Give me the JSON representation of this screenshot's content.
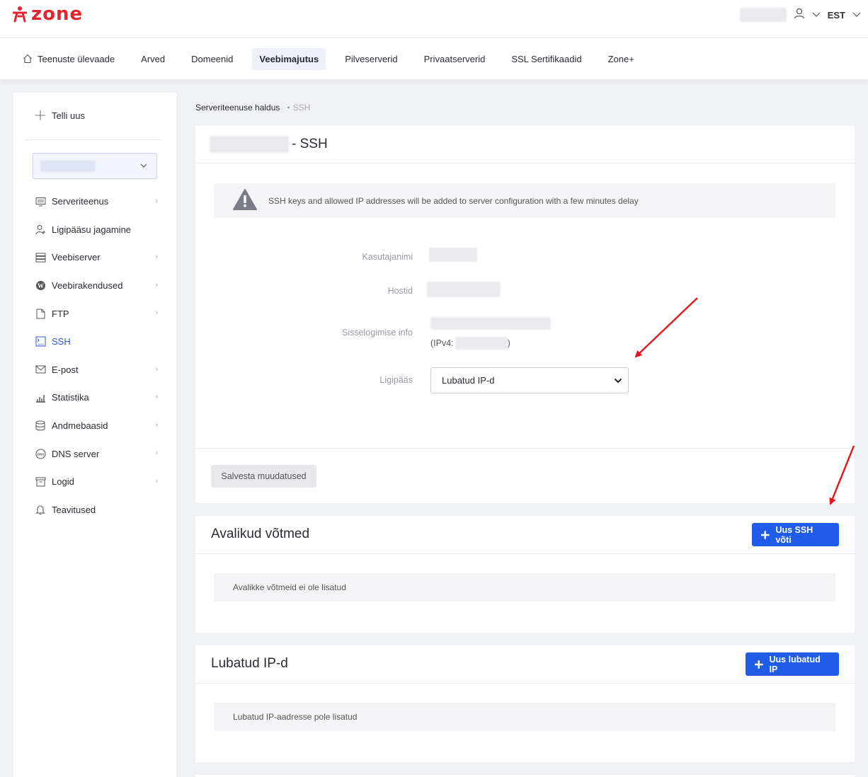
{
  "header": {
    "logo": "zone",
    "language": "EST"
  },
  "nav": {
    "items": [
      {
        "label": "Teenuste ülevaade",
        "icon": "home-icon"
      },
      {
        "label": "Arved"
      },
      {
        "label": "Domeenid"
      },
      {
        "label": "Veebimajutus",
        "active": true
      },
      {
        "label": "Pilveserverid"
      },
      {
        "label": "Privaatserverid"
      },
      {
        "label": "SSL Sertifikaadid"
      },
      {
        "label": "Zone+"
      }
    ]
  },
  "sidebar": {
    "order_new": "Telli uus",
    "items": [
      {
        "label": "Serveriteenus",
        "icon": "monitor-icon"
      },
      {
        "label": "Ligipääsu jagamine",
        "icon": "user-add-icon"
      },
      {
        "label": "Veebiserver",
        "icon": "server-icon"
      },
      {
        "label": "Veebirakendused",
        "icon": "wordpress-icon"
      },
      {
        "label": "FTP",
        "icon": "file-icon"
      },
      {
        "label": "SSH",
        "icon": "terminal-icon"
      },
      {
        "label": "E-post",
        "icon": "mail-icon"
      },
      {
        "label": "Statistika",
        "icon": "chart-icon"
      },
      {
        "label": "Andmebaasid",
        "icon": "database-icon"
      },
      {
        "label": "DNS server",
        "icon": "dns-icon"
      },
      {
        "label": "Logid",
        "icon": "archive-icon"
      },
      {
        "label": "Teavitused",
        "icon": "bell-icon"
      }
    ]
  },
  "breadcrumb": {
    "parent": "Serveriteenuse haldus",
    "current": "SSH"
  },
  "ssh_card": {
    "title_suffix": "- SSH",
    "notice": "SSH keys and allowed IP addresses will be added to server configuration with a few minutes delay",
    "username_label": "Kasutajanimi",
    "host_label": "Hostid",
    "login_label": "Sisselogimise info",
    "ipv4_prefix": "(IPv4:",
    "ipv4_suffix": ")",
    "access_label": "Ligipääs",
    "access_value": "Lubatud IP-d",
    "save_label": "Salvesta muudatused"
  },
  "keys_card": {
    "title": "Avalikud võtmed",
    "button": "Uus SSH võti",
    "empty": "Avalikke võtmeid ei ole lisatud"
  },
  "ips_card": {
    "title": "Lubatud IP-d",
    "button": "Uus lubatud IP",
    "empty": "Lubatud IP-aadresse pole lisatud"
  },
  "colors": {
    "brand": "#e4242d",
    "primary": "#1f5de8",
    "annotation_arrow": "#e8141b"
  }
}
